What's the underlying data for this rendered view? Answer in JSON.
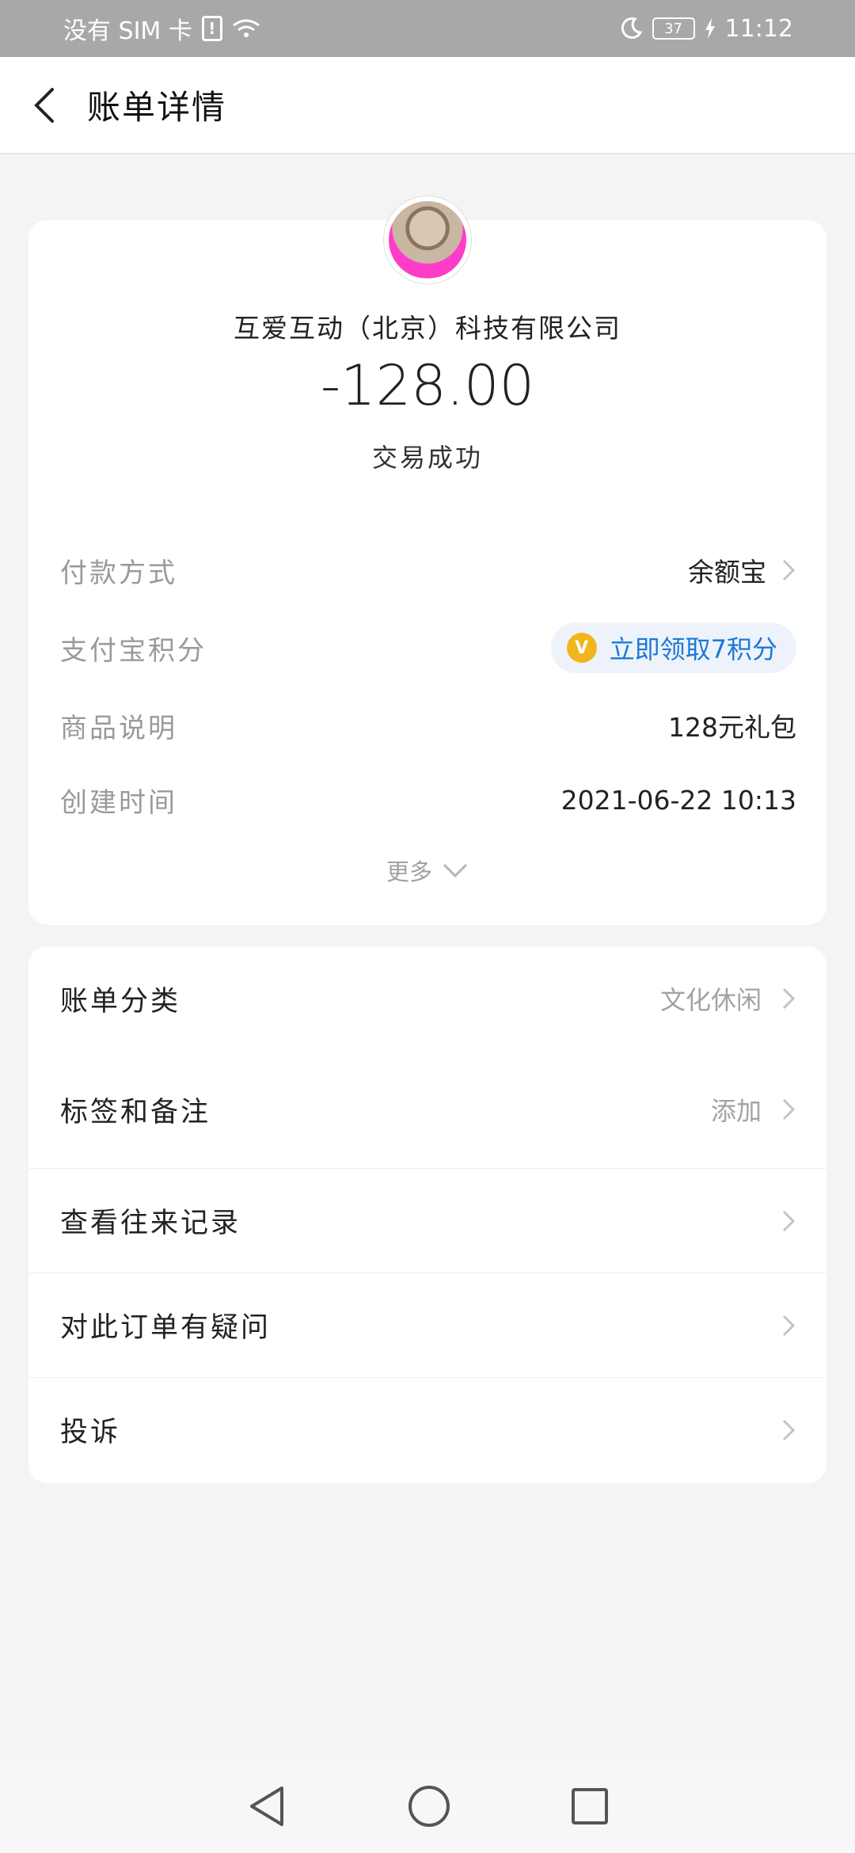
{
  "status_bar": {
    "carrier": "没有 SIM 卡",
    "battery": "37",
    "time": "11:12"
  },
  "header": {
    "title": "账单详情"
  },
  "transaction": {
    "merchant": "互爱互动（北京）科技有限公司",
    "amount": "-128.00",
    "status": "交易成功"
  },
  "details": {
    "payment_method_label": "付款方式",
    "payment_method_value": "余额宝",
    "points_label": "支付宝积分",
    "points_value": "立即领取7积分",
    "product_label": "商品说明",
    "product_value": "128元礼包",
    "created_label": "创建时间",
    "created_value": "2021-06-22 10:13",
    "more": "更多"
  },
  "menu": {
    "category_label": "账单分类",
    "category_value": "文化休闲",
    "tags_label": "标签和备注",
    "tags_value": "添加",
    "history_label": "查看往来记录",
    "question_label": "对此订单有疑问",
    "complaint_label": "投诉"
  },
  "colors": {
    "accent": "#1e78d6",
    "coin": "#f2b51e",
    "background": "#f4f4f5"
  }
}
